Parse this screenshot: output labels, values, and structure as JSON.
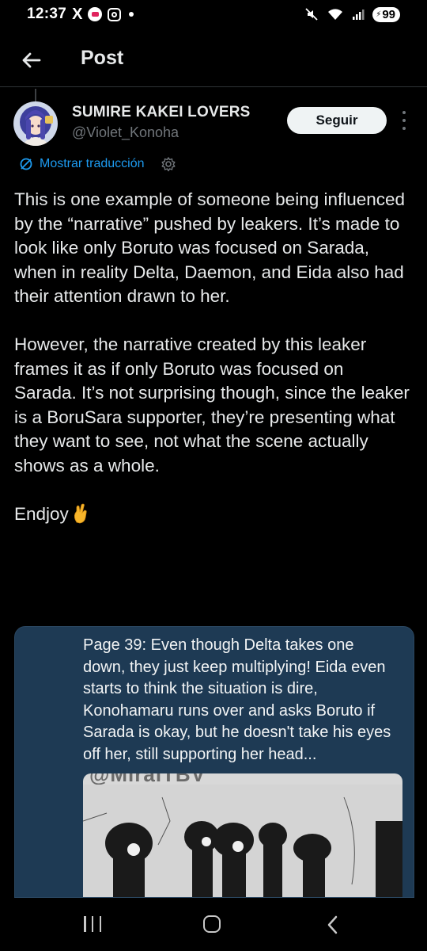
{
  "status_bar": {
    "time": "12:37",
    "x_glyph": "X",
    "battery_level": "99",
    "icons": [
      "x-app-icon",
      "notification-icon",
      "instagram-icon",
      "dot-icon",
      "mute-icon",
      "wifi-icon",
      "signal-icon",
      "battery-icon"
    ]
  },
  "header": {
    "title": "Post"
  },
  "post": {
    "author_name": "SUMIRE KAKEI LOVERS",
    "author_handle": "@Violet_Konoha",
    "follow_label": "Seguir",
    "translate_label": "Mostrar traducción",
    "paragraphs": [
      "This is one example of someone being influenced by the “narrative” pushed by leakers. It’s made to look like only Boruto was focused on Sarada, when in reality Delta, Daemon, and Eida also had their attention drawn to her.",
      "However, the narrative created by this leaker frames it as if only Boruto was focused on Sarada. It’s not surprising though, since the leaker is a BoruSara supporter, they’re presenting what they want to see, not what the scene actually shows as a whole.",
      "Endjoy"
    ],
    "media": {
      "caption": "Page 39: Even though Delta takes one down, they just keep multiplying! Eida even starts to think the situation is dire, Konohamaru runs over and asks Boruto if Sarada is okay, but he doesn't take his eyes off her, still supporting her head...",
      "watermark": "@MiraiTBV"
    }
  },
  "colors": {
    "background": "#000000",
    "text": "#e7e9ea",
    "muted": "#71767b",
    "link": "#1d9bf0",
    "media_bg": "#1e3a54"
  }
}
